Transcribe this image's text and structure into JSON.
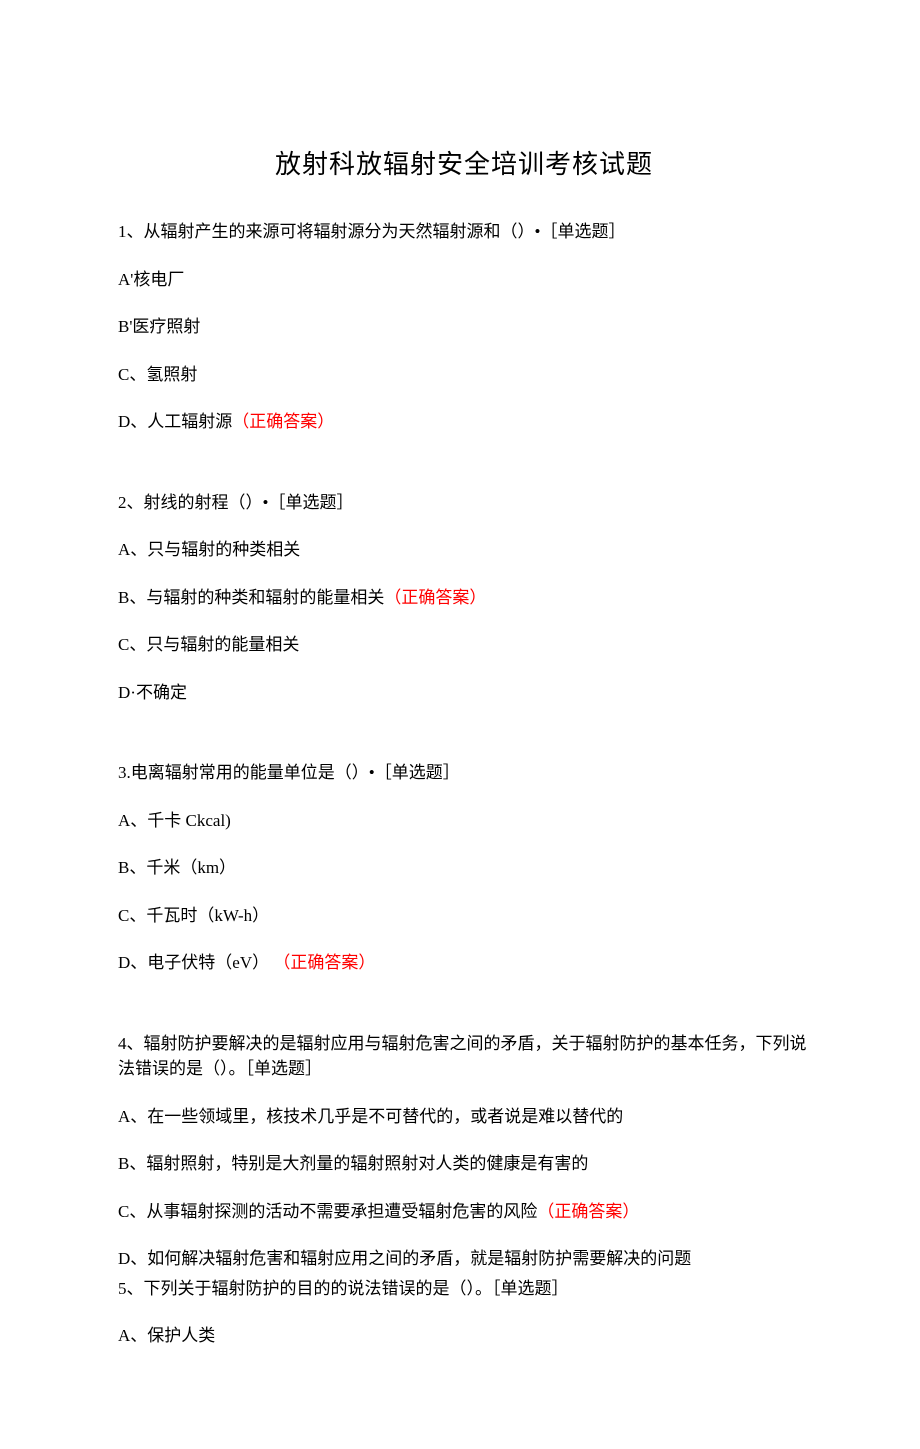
{
  "title": "放射科放辐射安全培训考核试题",
  "q1": {
    "stem": "1、从辐射产生的来源可将辐射源分为天然辐射源和（）•［单选题］",
    "a": "A'核电厂",
    "b": "B'医疗照射",
    "c": "C、氢照射",
    "d_pre": "D、人工辐射源",
    "d_ans": "（正确答案）"
  },
  "q2": {
    "stem": "2、射线的射程（）•［单选题］",
    "a": "A、只与辐射的种类相关",
    "b_pre": "B、与辐射的种类和辐射的能量相关",
    "b_ans": "（正确答案）",
    "c": "C、只与辐射的能量相关",
    "d": "D·不确定"
  },
  "q3": {
    "stem": "3.电离辐射常用的能量单位是（）•［单选题］",
    "a": "A、千卡 Ckcal)",
    "b": "B、千米（km）",
    "c": "C、千瓦时（kW-h）",
    "d_pre": "D、电子伏特（eV）",
    "d_ans": "（正确答案）"
  },
  "q4": {
    "stem": "4、辐射防护要解决的是辐射应用与辐射危害之间的矛盾，关于辐射防护的基本任务，下列说法错误的是（）。［单选题］",
    "a": "A、在一些领域里，核技术几乎是不可替代的，或者说是难以替代的",
    "b": "B、辐射照射，特别是大剂量的辐射照射对人类的健康是有害的",
    "c_pre": "C、从事辐射探测的活动不需要承担遭受辐射危害的风险",
    "c_ans": "（正确答案）",
    "d": "D、如何解决辐射危害和辐射应用之间的矛盾，就是辐射防护需要解决的问题"
  },
  "q5": {
    "stem": "5、下列关于辐射防护的目的的说法错误的是（）。［单选题］",
    "a": "A、保护人类"
  }
}
